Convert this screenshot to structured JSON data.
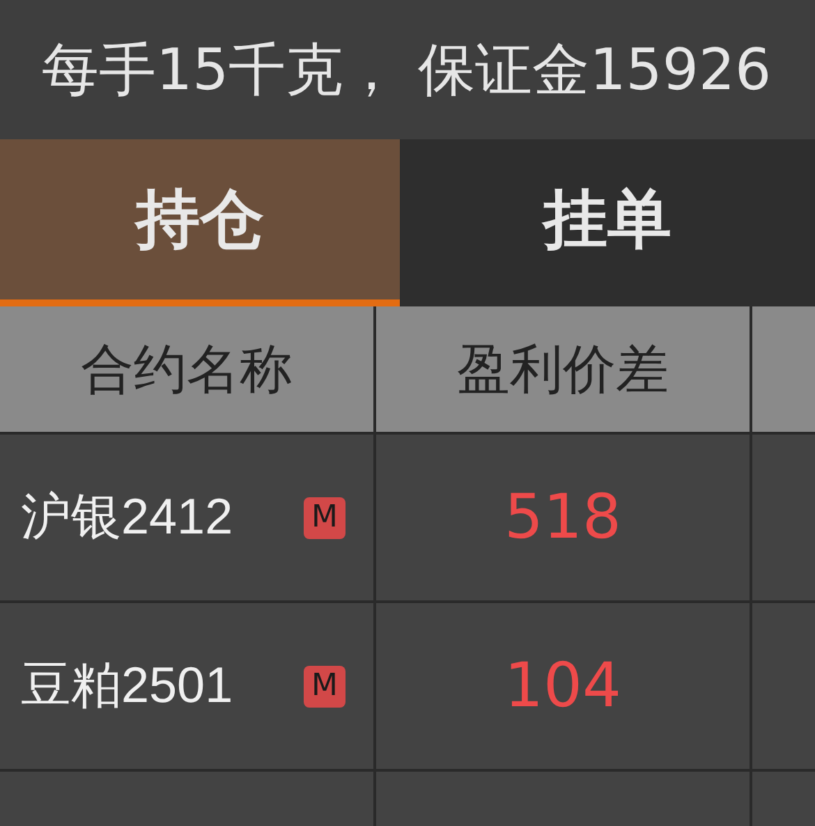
{
  "info_bar": {
    "text": "每手15千克， 保证金15926"
  },
  "tabs": [
    {
      "label": "持仓",
      "selected": true
    },
    {
      "label": "挂单",
      "selected": false
    }
  ],
  "table": {
    "columns": [
      "合约名称",
      "盈利价差"
    ],
    "rows": [
      {
        "contract": "沪银2412",
        "badge": "M",
        "spread": "518"
      },
      {
        "contract": "豆粕2501",
        "badge": "M",
        "spread": "104"
      }
    ]
  }
}
